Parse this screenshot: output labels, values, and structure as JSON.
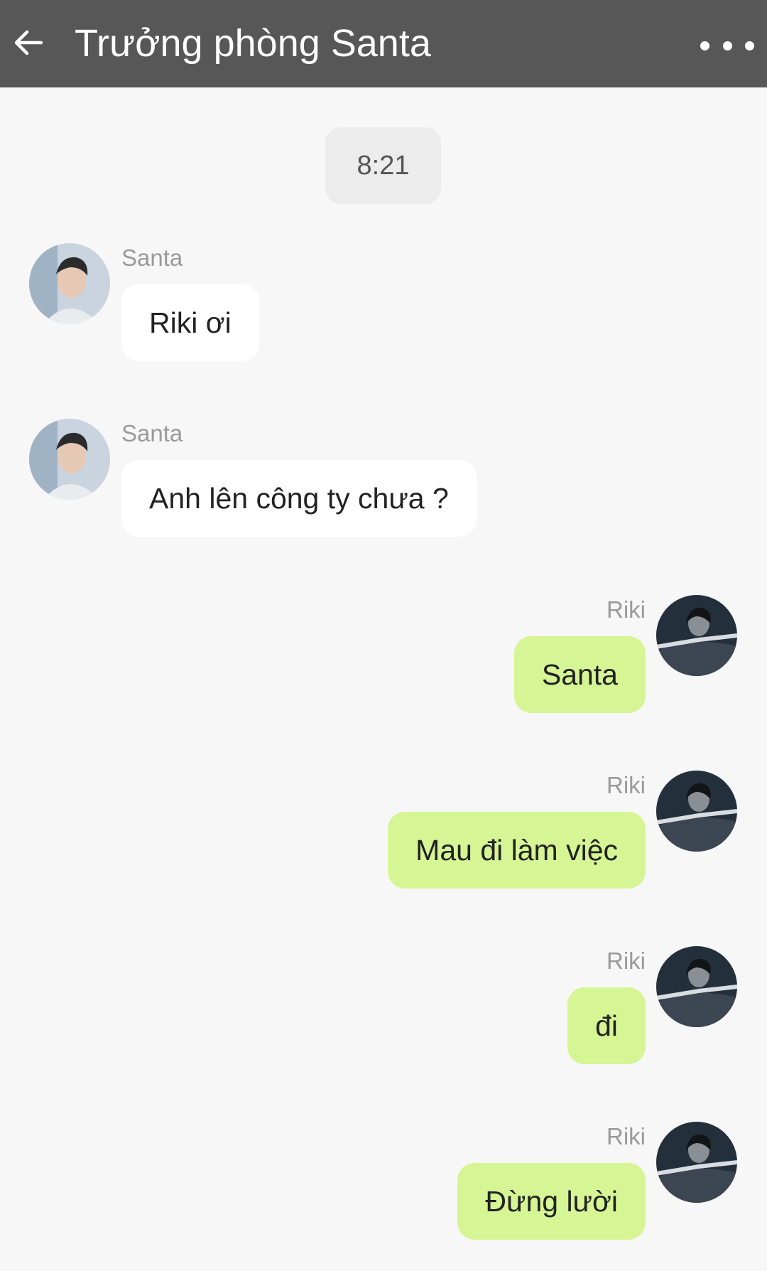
{
  "header": {
    "title": "Trưởng phòng Santa",
    "back_icon": "arrow-left-icon",
    "more_icon": "more-horizontal-icon",
    "background": "#575757"
  },
  "conversation": {
    "timestamp": "8:21",
    "messages": [
      {
        "side": "left",
        "sender": "Santa",
        "text": "Riki ơi"
      },
      {
        "side": "left",
        "sender": "Santa",
        "text": "Anh lên công ty chưa ?"
      },
      {
        "side": "right",
        "sender": "Riki",
        "text": "Santa"
      },
      {
        "side": "right",
        "sender": "Riki",
        "text": "Mau đi làm việc"
      },
      {
        "side": "right",
        "sender": "Riki",
        "text": "đi"
      },
      {
        "side": "right",
        "sender": "Riki",
        "text": "Đừng lười"
      }
    ]
  },
  "colors": {
    "sent_bubble": "#d6f595",
    "received_bubble": "#ffffff",
    "chat_background": "#f7f7f7"
  }
}
